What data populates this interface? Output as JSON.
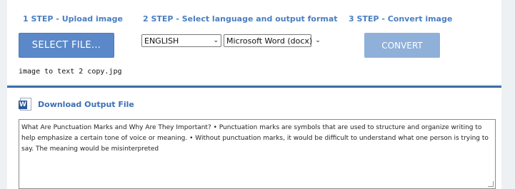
{
  "steps": {
    "step1": "1 STEP - Upload image",
    "step2": "2 STEP - Select language and output format",
    "step3": "3 STEP - Convert image"
  },
  "buttons": {
    "select_file": "SELECT FILE...",
    "convert": "CONVERT"
  },
  "selects": {
    "language": "ENGLISH",
    "format": "Microsoft Word (docx)"
  },
  "file_name": "image to text 2 copy.jpg",
  "download_label": "Download Output File",
  "output_text": "What Are Punctuation Marks and Why Are They Important? • Punctuation marks are symbols that are used to structure and organize writing to help emphasize a certain tone of voice or meaning. • Without punctuation marks, it would be difficult to understand what one person is trying to say. The meaning would be misinterpreted",
  "icons": {
    "download": "word-document-icon",
    "dropdown": "chevron-down-icon"
  },
  "colors": {
    "accent": "#4a7fc0",
    "button": "#5b88c8",
    "button_disabled": "#8fb0d8",
    "divider": "#3d6fa8"
  }
}
